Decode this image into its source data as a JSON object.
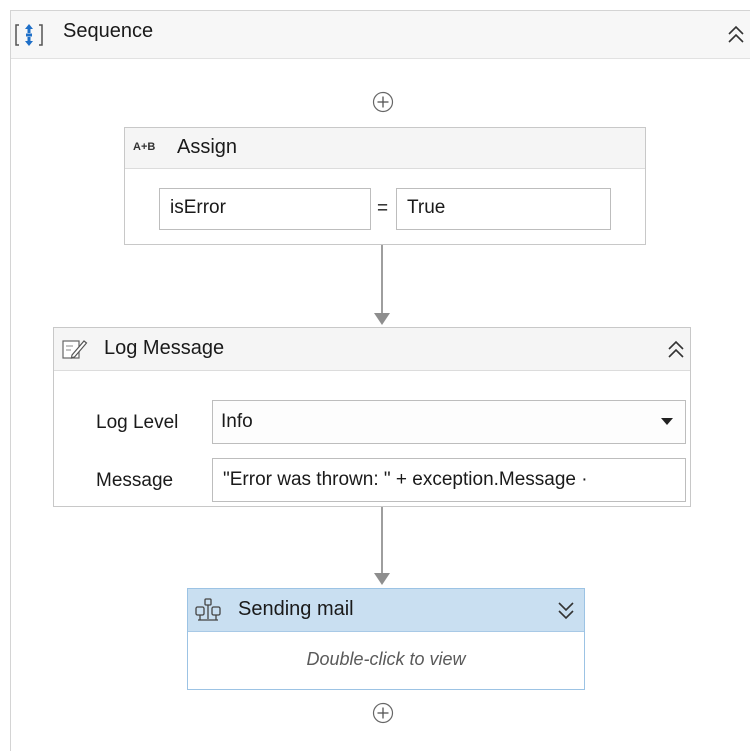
{
  "sequence": {
    "title": "Sequence",
    "icon": "sequence-icon",
    "collapse_icon": "double-chevron-up-icon"
  },
  "add_activity_icon": "plus-circle-icon",
  "assign": {
    "title": "Assign",
    "icon_text": "A+B",
    "left_value": "isError",
    "operator": "=",
    "right_value": "True"
  },
  "log_message": {
    "title": "Log Message",
    "icon": "log-message-icon",
    "collapse_icon": "double-chevron-up-icon",
    "log_level_label": "Log Level",
    "log_level_value": "Info",
    "dropdown_icon": "dropdown-arrow-icon",
    "message_label": "Message",
    "message_value": "\"Error was thrown: \" + exception.Message ·"
  },
  "sending_mail": {
    "title": "Sending mail",
    "icon": "workflow-icon",
    "expand_icon": "double-chevron-down-icon",
    "hint": "Double-click to view"
  },
  "colors": {
    "selected_header": "#c9dff1",
    "selected_border": "#9cc3e4",
    "connector": "#9e9e9e",
    "sequence_icon_blue": "#1e6fc8"
  }
}
